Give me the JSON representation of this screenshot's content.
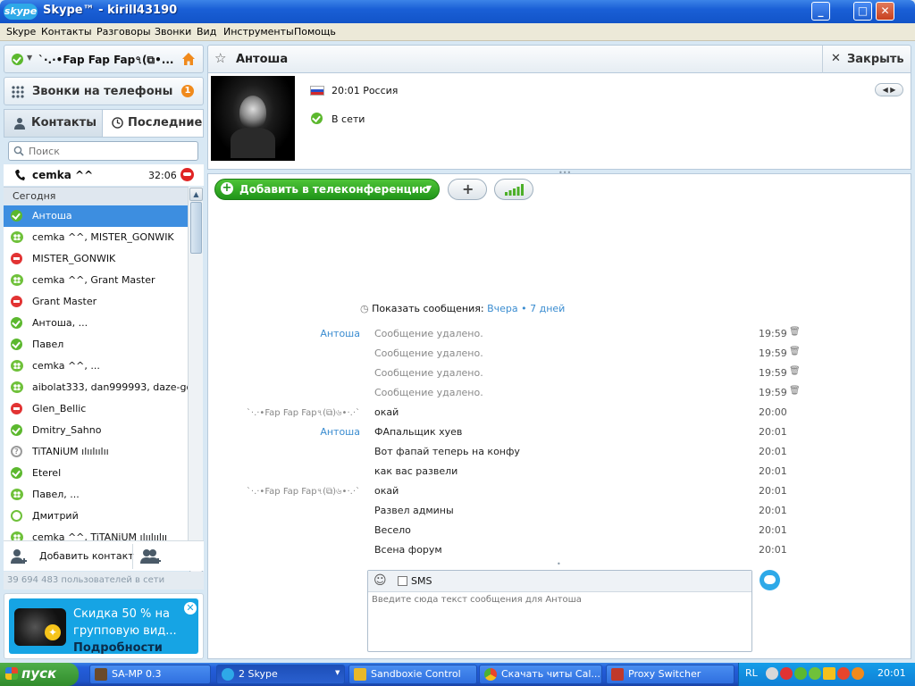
{
  "window": {
    "title": "Skype™ - kirill43190",
    "logo": "skype",
    "controls": {
      "minimize": "_",
      "maximize": "□",
      "close": "✕"
    }
  },
  "menu": [
    "Skype",
    "Контакты",
    "Разговоры",
    "Звонки",
    "Вид",
    "Инструменты",
    "Помощь"
  ],
  "status": {
    "name": "`·.·•Fap Fap Fap৭(⧉•...",
    "icon": "green-check-icon"
  },
  "phone_calls": {
    "label": "Звонки на телефоны",
    "badge": "1"
  },
  "tabs": {
    "contacts": "Контакты",
    "recent": "Последние"
  },
  "search": {
    "placeholder": "Поиск"
  },
  "active_call": {
    "name": "cemka ^^",
    "duration": "32:06"
  },
  "recent_header": "Сегодня",
  "contacts": [
    {
      "name": "Антоша",
      "status": "online",
      "selected": true
    },
    {
      "name": "cemka ^^, MISTER_GONWIK",
      "status": "group"
    },
    {
      "name": "MISTER_GONWIK",
      "status": "dnd"
    },
    {
      "name": "cemka ^^, Grant Master",
      "status": "group"
    },
    {
      "name": "Grant Master",
      "status": "dnd"
    },
    {
      "name": "Антоша, ...",
      "status": "online"
    },
    {
      "name": "Павел",
      "status": "online"
    },
    {
      "name": "cemka ^^, ...",
      "status": "group"
    },
    {
      "name": "aibolat333, dan999993, daze-go...",
      "status": "group"
    },
    {
      "name": "Glen_Bellic",
      "status": "dnd"
    },
    {
      "name": "Dmitry_Sahno",
      "status": "online"
    },
    {
      "name": "TiTANiUM ılıılıılıı",
      "status": "unknown"
    },
    {
      "name": "Eterel",
      "status": "online"
    },
    {
      "name": "Павел, ...",
      "status": "group"
    },
    {
      "name": "Дмитрий",
      "status": "offline"
    },
    {
      "name": "cemka ^^, TiTANiUM ılıılıılıı",
      "status": "group"
    }
  ],
  "add_contact": "Добавить контакт",
  "users_online": "39 694 483 пользователей в сети",
  "promo": {
    "line1": "Скидка 50 % на",
    "line2": "групповую вид...",
    "link": "Подробности"
  },
  "chat": {
    "contact_name": "Антоша",
    "close_label": "Закрыть",
    "local_time": "20:01 Россия",
    "presence": "В сети",
    "add_conf": "Добавить в телеконференцию",
    "show_messages": "Показать сообщения:",
    "yesterday": "Вчера",
    "seven_days": "7 дней",
    "messages": [
      {
        "author": "Антоша",
        "text": "Сообщение удалено.",
        "time": "19:59",
        "deleted": true,
        "me": false
      },
      {
        "author": "",
        "text": "Сообщение удалено.",
        "time": "19:59",
        "deleted": true,
        "me": false
      },
      {
        "author": "",
        "text": "Сообщение удалено.",
        "time": "19:59",
        "deleted": true,
        "me": false
      },
      {
        "author": "",
        "text": "Сообщение удалено.",
        "time": "19:59",
        "deleted": true,
        "me": false
      },
      {
        "author": "`·.·•Fap Fap Fap৭(⧉)৬•·.·`",
        "text": "окай",
        "time": "20:00",
        "deleted": false,
        "me": true
      },
      {
        "author": "Антоша",
        "text": "ФАпальщик хуев",
        "time": "20:01",
        "deleted": false,
        "me": false
      },
      {
        "author": "",
        "text": "Вот фапай теперь на конфу",
        "time": "20:01",
        "deleted": false,
        "me": false
      },
      {
        "author": "",
        "text": "как вас развели",
        "time": "20:01",
        "deleted": false,
        "me": false
      },
      {
        "author": "`·.·•Fap Fap Fap৭(⧉)৬•·.·`",
        "text": "окай",
        "time": "20:01",
        "deleted": false,
        "me": true
      },
      {
        "author": "",
        "text": "Развел админы",
        "time": "20:01",
        "deleted": false,
        "me": true
      },
      {
        "author": "",
        "text": "Весело",
        "time": "20:01",
        "deleted": false,
        "me": true
      },
      {
        "author": "",
        "text": "Всена форум",
        "time": "20:01",
        "deleted": false,
        "me": true
      }
    ],
    "sms_label": "SMS",
    "input_placeholder": "Введите сюда текст сообщения для Антоша"
  },
  "taskbar": {
    "start": "пуск",
    "items": [
      "SA-MP 0.3",
      "2 Skype",
      "Sandboxie Control",
      "Скачать читы Cal...",
      "Proxy Switcher"
    ],
    "lang": "RL",
    "clock": "20:01"
  },
  "colors": {
    "accent": "#3d8ee0",
    "online": "#5cb82e",
    "dnd": "#e23333",
    "promo": "#16a4e4",
    "taskbar": "#245edb"
  }
}
